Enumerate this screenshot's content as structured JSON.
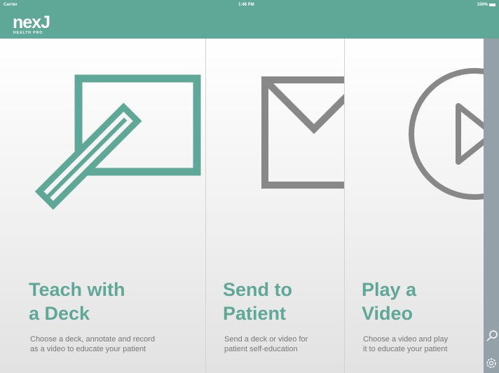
{
  "status_bar": {
    "carrier": "Carrier",
    "time": "1:48 PM",
    "battery": "100%"
  },
  "brand": {
    "logo": "nexJ",
    "sub": "HEALTH PRO",
    "color": "#5fa898"
  },
  "panels": [
    {
      "title_line1": "Teach with",
      "title_line2": "a Deck",
      "desc_line1": "Choose a deck, annotate and record",
      "desc_line2": "as a video to educate your patient",
      "icon": "deck-pencil-icon",
      "icon_color": "#5fa898"
    },
    {
      "title_line1": "Send to",
      "title_line2": "Patient",
      "desc_line1": "Send a deck or video for",
      "desc_line2": "patient self-education",
      "icon": "envelope-icon",
      "icon_color": "#888888"
    },
    {
      "title_line1": "Play a",
      "title_line2": "Video",
      "desc_line1": "Choose a video and play",
      "desc_line2": "it to educate your patient",
      "icon": "play-icon",
      "icon_color": "#888888"
    }
  ],
  "sidebar": {
    "icons": [
      "search-icon",
      "gear-icon"
    ]
  }
}
